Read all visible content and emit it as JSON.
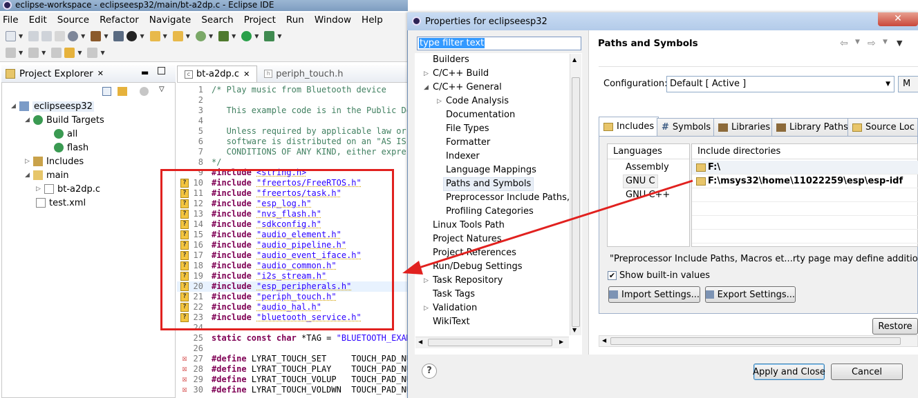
{
  "main_window": {
    "title": "eclipse-workspace - eclipseesp32/main/bt-a2dp.c - Eclipse IDE",
    "menu": [
      "File",
      "Edit",
      "Source",
      "Refactor",
      "Navigate",
      "Search",
      "Project",
      "Run",
      "Window",
      "Help"
    ]
  },
  "project_explorer": {
    "tab_label": "Project Explorer",
    "items": [
      {
        "label": "eclipseesp32",
        "icon": "project-icon"
      },
      {
        "label": "Build Targets",
        "icon": "build-targets-icon"
      },
      {
        "label": "all",
        "icon": "target-icon"
      },
      {
        "label": "flash",
        "icon": "target-icon"
      },
      {
        "label": "Includes",
        "icon": "includes-icon"
      },
      {
        "label": "main",
        "icon": "folder-icon"
      },
      {
        "label": "bt-a2dp.c",
        "icon": "c-file-icon"
      },
      {
        "label": "test.xml",
        "icon": "xml-file-icon"
      }
    ]
  },
  "editor": {
    "tabs": [
      "bt-a2dp.c",
      "periph_touch.h"
    ],
    "lines": [
      {
        "n": "1",
        "text": "/* Play music from Bluetooth device",
        "type": "comment"
      },
      {
        "n": "2",
        "text": "",
        "type": "comment"
      },
      {
        "n": "3",
        "text": "   This example code is in the Public Do",
        "type": "comment"
      },
      {
        "n": "4",
        "text": "",
        "type": "comment"
      },
      {
        "n": "5",
        "text": "   Unless required by applicable law or ",
        "type": "comment"
      },
      {
        "n": "6",
        "text": "   software is distributed on an \"AS IS\"",
        "type": "comment"
      },
      {
        "n": "7",
        "text": "   CONDITIONS OF ANY KIND, either expres",
        "type": "comment"
      },
      {
        "n": "8",
        "text": "*/",
        "type": "comment"
      },
      {
        "n": "9",
        "kw": "#include ",
        "str": "<string.h>",
        "type": "include"
      },
      {
        "n": "10",
        "kw": "#include ",
        "str": "\"freertos/FreeRTOS.h\"",
        "type": "include",
        "marker": "warn"
      },
      {
        "n": "11",
        "kw": "#include ",
        "str": "\"freertos/task.h\"",
        "type": "include",
        "marker": "warn"
      },
      {
        "n": "12",
        "kw": "#include ",
        "str": "\"esp_log.h\"",
        "type": "include",
        "marker": "warn"
      },
      {
        "n": "13",
        "kw": "#include ",
        "str": "\"nvs_flash.h\"",
        "type": "include",
        "marker": "warn"
      },
      {
        "n": "14",
        "kw": "#include ",
        "str": "\"sdkconfig.h\"",
        "type": "include",
        "marker": "warn"
      },
      {
        "n": "15",
        "kw": "#include ",
        "str": "\"audio_element.h\"",
        "type": "include",
        "marker": "warn"
      },
      {
        "n": "16",
        "kw": "#include ",
        "str": "\"audio_pipeline.h\"",
        "type": "include",
        "marker": "warn"
      },
      {
        "n": "17",
        "kw": "#include ",
        "str": "\"audio_event_iface.h\"",
        "type": "include",
        "marker": "warn"
      },
      {
        "n": "18",
        "kw": "#include ",
        "str": "\"audio_common.h\"",
        "type": "include",
        "marker": "warn"
      },
      {
        "n": "19",
        "kw": "#include ",
        "str": "\"i2s_stream.h\"",
        "type": "include",
        "marker": "warn"
      },
      {
        "n": "20",
        "kw": "#include ",
        "str": "\"esp_peripherals.h\"",
        "type": "include",
        "marker": "warn"
      },
      {
        "n": "21",
        "kw": "#include ",
        "str": "\"periph_touch.h\"",
        "type": "include",
        "marker": "warn"
      },
      {
        "n": "22",
        "kw": "#include ",
        "str": "\"audio_hal.h\"",
        "type": "include",
        "marker": "warn"
      },
      {
        "n": "23",
        "kw": "#include ",
        "str": "\"bluetooth_service.h\"",
        "type": "include",
        "marker": "warn"
      },
      {
        "n": "24",
        "text": "",
        "type": "plain"
      },
      {
        "n": "25",
        "kw": "static const char ",
        "plain": "*TAG = ",
        "str": "\"BLUETOOTH_EXAM",
        "type": "decl"
      },
      {
        "n": "26",
        "text": "",
        "type": "plain"
      },
      {
        "n": "27",
        "kw": "#define ",
        "plain": "LYRAT_TOUCH_SET     TOUCH_PAD_NU",
        "type": "define",
        "marker": "err"
      },
      {
        "n": "28",
        "kw": "#define ",
        "plain": "LYRAT_TOUCH_PLAY    TOUCH_PAD_NU",
        "type": "define",
        "marker": "err"
      },
      {
        "n": "29",
        "kw": "#define ",
        "plain": "LYRAT_TOUCH_VOLUP   TOUCH_PAD_NU",
        "type": "define",
        "marker": "err"
      },
      {
        "n": "30",
        "kw": "#define ",
        "plain": "LYRAT_TOUCH_VOLDWN  TOUCH_PAD_NU",
        "type": "define",
        "marker": "err"
      }
    ]
  },
  "dialog": {
    "title": "Properties for eclipseesp32",
    "close": "✕",
    "filter_placeholder": "type filter text",
    "tree": [
      {
        "label": "Builders",
        "level": 0,
        "twist": ""
      },
      {
        "label": "C/C++ Build",
        "level": 0,
        "twist": "▷"
      },
      {
        "label": "C/C++ General",
        "level": 0,
        "twist": "◢"
      },
      {
        "label": "Code Analysis",
        "level": 1,
        "twist": "▷"
      },
      {
        "label": "Documentation",
        "level": 1,
        "twist": ""
      },
      {
        "label": "File Types",
        "level": 1,
        "twist": ""
      },
      {
        "label": "Formatter",
        "level": 1,
        "twist": ""
      },
      {
        "label": "Indexer",
        "level": 1,
        "twist": ""
      },
      {
        "label": "Language Mappings",
        "level": 1,
        "twist": ""
      },
      {
        "label": "Paths and Symbols",
        "level": 1,
        "twist": "",
        "selected": true
      },
      {
        "label": "Preprocessor Include Paths, M",
        "level": 1,
        "twist": ""
      },
      {
        "label": "Profiling Categories",
        "level": 1,
        "twist": ""
      },
      {
        "label": "Linux Tools Path",
        "level": 0,
        "twist": ""
      },
      {
        "label": "Project Natures",
        "level": 0,
        "twist": ""
      },
      {
        "label": "Project References",
        "level": 0,
        "twist": ""
      },
      {
        "label": "Run/Debug Settings",
        "level": 0,
        "twist": ""
      },
      {
        "label": "Task Repository",
        "level": 0,
        "twist": "▷"
      },
      {
        "label": "Task Tags",
        "level": 0,
        "twist": ""
      },
      {
        "label": "Validation",
        "level": 0,
        "twist": "▷"
      },
      {
        "label": "WikiText",
        "level": 0,
        "twist": ""
      }
    ],
    "page_title": "Paths and Symbols",
    "configuration_label": "Configuration:",
    "configuration_value": "Default  [ Active ]",
    "manage_button": "M",
    "tabs": [
      {
        "label": "Includes",
        "icon": "includes-tab-icon"
      },
      {
        "label": "Symbols",
        "icon": "hash-icon"
      },
      {
        "label": "Libraries",
        "icon": "libraries-icon"
      },
      {
        "label": "Library Paths",
        "icon": "library-paths-icon"
      },
      {
        "label": "Source Loc",
        "icon": "source-location-icon"
      }
    ],
    "languages_header": "Languages",
    "languages": [
      "Assembly",
      "GNU C",
      "GNU C++"
    ],
    "include_dirs_header": "Include directories",
    "include_dirs": [
      "F:\\",
      "F:\\msys32\\home\\11022259\\esp\\esp-idf"
    ],
    "note": "\"Preprocessor Include Paths, Macros et...rty page may define additional en",
    "show_builtin_label": "Show built-in values",
    "import_button": "Import Settings...",
    "export_button": "Export Settings...",
    "restore_button": "Restore",
    "apply_close_button": "Apply and Close",
    "cancel_button": "Cancel",
    "help": "?"
  },
  "colors": {
    "annotation_red": "#e1211f",
    "keyword": "#7f0055",
    "string": "#2a00ff",
    "comment": "#3f7f5f"
  }
}
